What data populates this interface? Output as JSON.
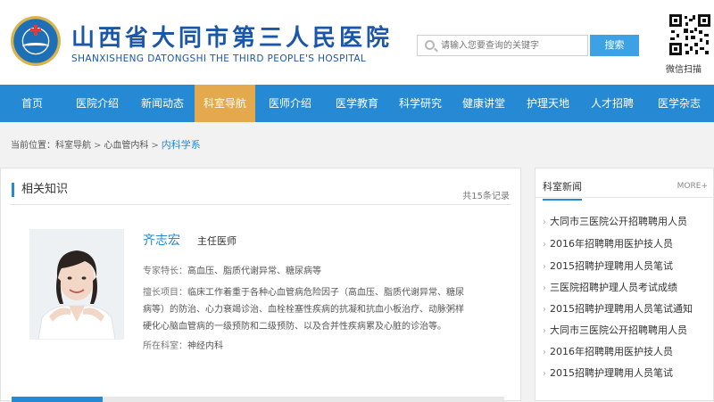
{
  "header": {
    "hospital_name_cn": "山西省大同市第三人民医院",
    "hospital_name_en": "SHANXISHENG DATONGSHI THE THIRD PEOPLE'S HOSPITAL",
    "search_placeholder": "请输入您要查询的关键字",
    "search_button": "搜索",
    "qr_caption": "微信扫描"
  },
  "nav": {
    "items": [
      "首页",
      "医院介绍",
      "新闻动态",
      "科室导航",
      "医师介绍",
      "医学教育",
      "科学研究",
      "健康讲堂",
      "护理天地",
      "人才招聘",
      "医学杂志"
    ],
    "active": "科室导航"
  },
  "breadcrumb": {
    "prefix": "当前位置：",
    "items": [
      "科室导航",
      "心血管内科"
    ],
    "current": "内科学系",
    "separator": ">"
  },
  "main": {
    "title": "相关知识",
    "count": "共15条记录",
    "doctor": {
      "name": "齐志宏",
      "title": "主任医师",
      "specialty_label": "专家特长：",
      "specialty": "高血压、脂质代谢异常、糖尿病等",
      "projects_label": "擅长项目：",
      "projects_line1": "临床工作着重于各种心血管病危险因子（高血压、脂质代谢异常、糖尿",
      "projects_line2": "病等）的防治、心力衰竭诊治、血栓栓塞性疾病的抗凝和抗血小板治疗、动脉粥样",
      "projects_line3": "硬化心脑血管病的一级预防和二级预防、以及合并性疾病累及心脏的诊治等。",
      "dept_label": "所在科室：",
      "dept": "神经内科"
    }
  },
  "sidebar": {
    "title": "科室新闻",
    "more": "MORE+",
    "items": [
      "大同市三医院公开招聘聘用人员",
      "2016年招聘聘用医护技人员",
      "2015招聘护理聘用人员笔试",
      "三医院招聘护理人员考试成绩",
      "2015招聘护理聘用人员笔试通知",
      "大同市三医院公开招聘聘用人员",
      "2016年招聘聘用医护技人员",
      "2015招聘护理聘用人员笔试"
    ]
  },
  "colors": {
    "nav_bg": "#2589d4",
    "nav_active": "#e5a94d",
    "brand_text": "#1b57a6",
    "link": "#2589d4"
  }
}
